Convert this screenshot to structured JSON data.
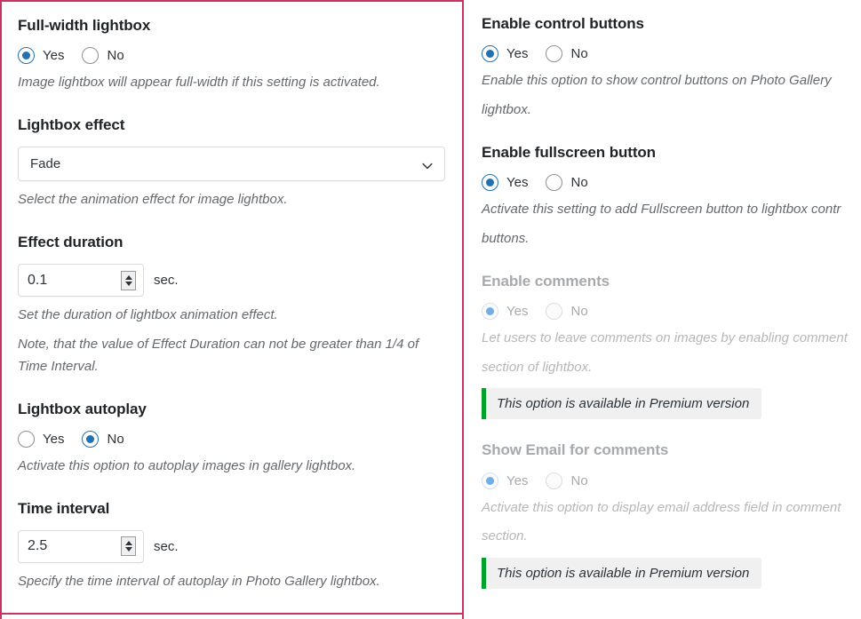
{
  "colors": {
    "highlight_border": "#c9335f",
    "radio_accent": "#2271b1",
    "radio_accent_disabled": "#72aee6",
    "premium_accent": "#00a32a",
    "premium_bg": "#f0f0f1",
    "heading": "#1d2327",
    "heading_disabled": "#a7aaad",
    "description": "#646970"
  },
  "radio_options": {
    "yes": "Yes",
    "no": "No"
  },
  "premium_notice": "This option is available in Premium version",
  "left_column": {
    "highlighted": true,
    "fields": [
      {
        "title": "Full-width lightbox",
        "type": "radio",
        "selected": "Yes",
        "descriptions": [
          "Image lightbox will appear full-width if this setting is activated."
        ]
      },
      {
        "title": "Lightbox effect",
        "type": "select",
        "value": "Fade",
        "descriptions": [
          "Select the animation effect for image lightbox."
        ]
      },
      {
        "title": "Effect duration",
        "type": "number",
        "value": "0.1",
        "suffix": "sec.",
        "descriptions": [
          "Set the duration of lightbox animation effect.",
          "Note, that the value of Effect Duration can not be greater than 1/4 of Time Interval."
        ]
      },
      {
        "title": "Lightbox autoplay",
        "type": "radio",
        "selected": "No",
        "descriptions": [
          "Activate this option to autoplay images in gallery lightbox."
        ]
      },
      {
        "title": "Time interval",
        "type": "number",
        "value": "2.5",
        "suffix": "sec.",
        "descriptions": [
          "Specify the time interval of autoplay in Photo Gallery lightbox."
        ]
      }
    ]
  },
  "right_column": {
    "fields": [
      {
        "title": "Enable control buttons",
        "type": "radio",
        "selected": "Yes",
        "disabled": false,
        "descriptions": [
          "Enable this option to show control buttons on Photo Gallery",
          "lightbox."
        ]
      },
      {
        "title": "Enable fullscreen button",
        "type": "radio",
        "selected": "Yes",
        "disabled": false,
        "descriptions": [
          "Activate this setting to add Fullscreen button to lightbox contr",
          "buttons."
        ]
      },
      {
        "title": "Enable comments",
        "type": "radio",
        "selected": "Yes",
        "disabled": true,
        "descriptions": [
          "Let users to leave comments on images by enabling comment",
          "section of lightbox."
        ],
        "premium": "This option is available in Premium version"
      },
      {
        "title": "Show Email for comments",
        "type": "radio",
        "selected": "Yes",
        "disabled": true,
        "descriptions": [
          "Activate this option to display email address field in comment",
          "section."
        ],
        "premium": "This option is available in Premium version"
      }
    ]
  }
}
